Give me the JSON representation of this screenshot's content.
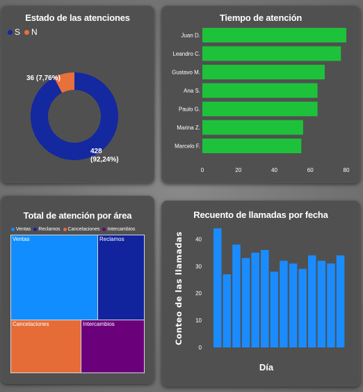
{
  "chart_data": [
    {
      "type": "pie",
      "title": "Estado de las atenciones",
      "legend": {
        "placement": "top-left",
        "entries": [
          "S",
          "N"
        ]
      },
      "slices": [
        {
          "name": "S",
          "value": 428,
          "label": "428\n(92,24%)",
          "color": "#1428A0"
        },
        {
          "name": "N",
          "value": 36,
          "label": "36 (7,76%)",
          "color": "#E8703A"
        }
      ]
    },
    {
      "type": "bar",
      "orientation": "horizontal",
      "title": "Tiempo de atención",
      "categories": [
        "Juan D.",
        "Leandro C.",
        "Gustavo M.",
        "Ana S.",
        "Paulo G.",
        "Marina Z.",
        "Marcelo F."
      ],
      "values": [
        80,
        77,
        68,
        64,
        64,
        56,
        55
      ],
      "xlim": [
        0,
        80
      ],
      "xticks": [
        "0",
        "20",
        "40",
        "60",
        "80"
      ],
      "grid": false,
      "color": "#1DC23A"
    },
    {
      "type": "treemap",
      "title": "Total de atención por área",
      "legend": {
        "placement": "top-left"
      },
      "items": [
        {
          "name": "Ventas",
          "color": "#118DFF"
        },
        {
          "name": "Reclamos",
          "color": "#12239E"
        },
        {
          "name": "Cancelaciones",
          "color": "#E66C37"
        },
        {
          "name": "Intercambios",
          "color": "#6B007B"
        }
      ]
    },
    {
      "type": "bar",
      "title": "Recuento de llamadas por fecha",
      "xlabel": "Día",
      "ylabel": "Conteo de las llamadas",
      "values": [
        44,
        27,
        38,
        33,
        35,
        36,
        28,
        32,
        31,
        29,
        34,
        32,
        31,
        34
      ],
      "ylim": [
        0,
        45
      ],
      "yticks": [
        "0",
        "10",
        "20",
        "30",
        "40"
      ],
      "grid": false,
      "color": "#1A8CFF"
    }
  ]
}
